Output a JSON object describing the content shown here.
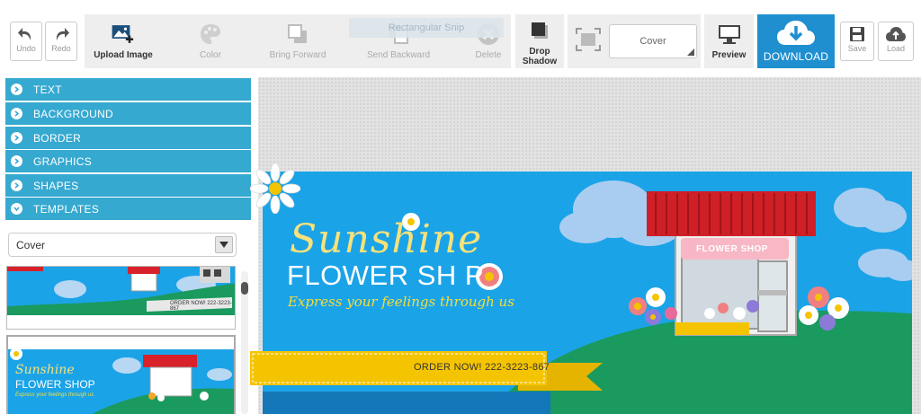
{
  "toolbar": {
    "undo": "Undo",
    "redo": "Redo",
    "upload_image": "Upload Image",
    "color": "Color",
    "bring_forward": "Bring Forward",
    "send_backward": "Send Backward",
    "delete": "Delete",
    "drop_shadow": "Drop Shadow",
    "size_value": "Cover",
    "preview": "Preview",
    "download": "DOWNLOAD",
    "save": "Save",
    "load": "Load",
    "ghost_overlay": "Rectangular Snip"
  },
  "sidebar": {
    "sections": [
      {
        "label": "TEXT"
      },
      {
        "label": "BACKGROUND"
      },
      {
        "label": "BORDER"
      },
      {
        "label": "GRAPHICS"
      },
      {
        "label": "SHAPES"
      },
      {
        "label": "TEMPLATES"
      }
    ],
    "template_category": "Cover",
    "thumbnails": {
      "first_cta": "ORDER NOW! 222-3223-867",
      "second_line1": "Sunshine",
      "second_line2": "FLOWER SHOP",
      "second_tag": "Express your feelings through us"
    }
  },
  "canvas": {
    "title_line1": "Sunshine",
    "title_line2": "FLOWER SH  P",
    "tagline": "Express your feelings through us",
    "cta": "ORDER NOW! 222-3223-867",
    "shop_sign": "FLOWER SHOP"
  },
  "colors": {
    "accent": "#36a9d0",
    "download": "#1f8fd0",
    "banner_sky": "#1ba3e8",
    "hill": "#1a9a5e",
    "ribbon": "#f5c400",
    "awning": "#d8212a"
  }
}
